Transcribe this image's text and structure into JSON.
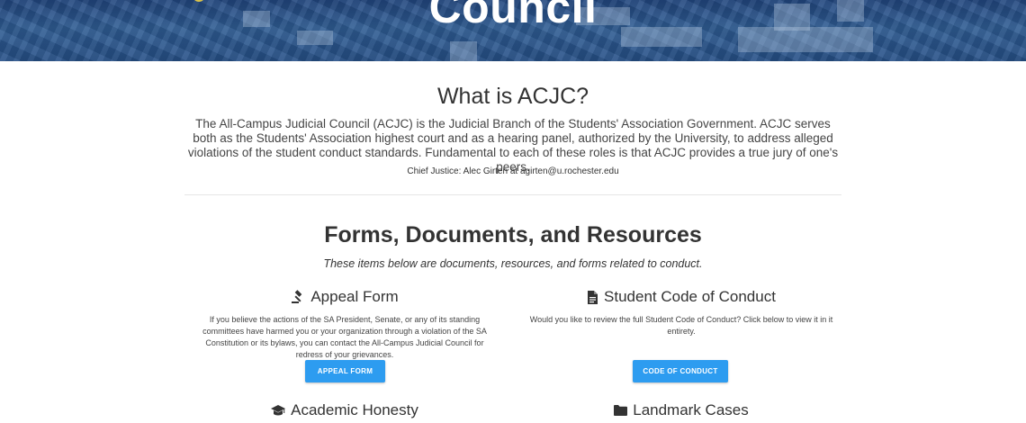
{
  "hero": {
    "title": "Council"
  },
  "about": {
    "heading": "What is ACJC?",
    "description": "The All-Campus Judicial Council (ACJC) is the Judicial Branch of the Students' Association Government. ACJC serves both as the Students' Association highest court and as a hearing panel, authorized by the University, to address alleged violations of the student conduct standards. Fundamental to each of these roles is that ACJC provides a true jury of one's peers.",
    "chief_justice": "Chief Justice: Alec Girten at agirten@u.rochester.edu"
  },
  "resources": {
    "heading": "Forms, Documents, and Resources",
    "subheading": "These items below are documents, resources, and forms related to conduct.",
    "cards": [
      {
        "icon": "gavel-icon",
        "title": "Appeal Form",
        "description": "If you believe the actions of the SA President, Senate, or any of its standing committees have harmed you or your organization through a violation of the SA Constitution or its bylaws, you can contact the All-Campus Judicial Council for redress of your grievances.",
        "button_label": "APPEAL FORM"
      },
      {
        "icon": "document-icon",
        "title": "Student Code of Conduct",
        "description": "Would you like to review the full Student Code of Conduct? Click below to view it in it entirety.",
        "button_label": "CODE OF CONDUCT"
      },
      {
        "icon": "graduation-cap-icon",
        "title": "Academic Honesty"
      },
      {
        "icon": "folder-icon",
        "title": "Landmark Cases"
      }
    ]
  },
  "colors": {
    "hero_blue": "#2f5c93",
    "button_blue": "#2d9cf0"
  }
}
